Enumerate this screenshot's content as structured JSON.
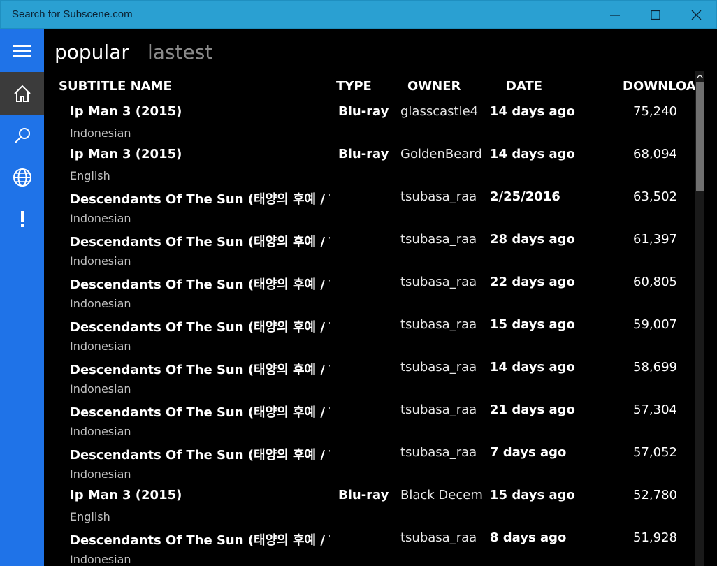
{
  "window": {
    "title": "Search for Subscene.com",
    "minimize_icon": "minimize-icon",
    "maximize_icon": "maximize-icon",
    "close_icon": "close-icon"
  },
  "sidebar": {
    "accent": "#1f73e8",
    "items": [
      {
        "icon": "hamburger-menu-icon"
      },
      {
        "icon": "home-icon",
        "selected": true
      },
      {
        "icon": "search-icon"
      },
      {
        "icon": "globe-icon"
      },
      {
        "icon": "exclamation-icon"
      }
    ]
  },
  "pivot": {
    "tabs": [
      {
        "label": "popular",
        "active": true
      },
      {
        "label": "lastest",
        "active": false
      }
    ]
  },
  "table": {
    "columns": [
      "SUBTITLE NAME",
      "TYPE",
      "OWNER",
      "DATE",
      "DOWNLOAD"
    ],
    "rows": [
      {
        "name": "Ip Man 3 (2015)",
        "lang": "Indonesian",
        "type": "Blu-ray",
        "owner": "glasscastle4",
        "date": "14 days ago",
        "downloads": "75,240"
      },
      {
        "name": "Ip Man 3 (2015)",
        "lang": "English",
        "type": "Blu-ray",
        "owner": "GoldenBeard",
        "date": "14 days ago",
        "downloads": "68,094"
      },
      {
        "name": "Descendants Of The Sun (태양의 후예 / Tae",
        "lang": "Indonesian",
        "type": "",
        "owner": "tsubasa_raa",
        "date": "2/25/2016",
        "downloads": "63,502"
      },
      {
        "name": "Descendants Of The Sun (태양의 후예 / Tae",
        "lang": "Indonesian",
        "type": "",
        "owner": "tsubasa_raa",
        "date": "28 days ago",
        "downloads": "61,397"
      },
      {
        "name": "Descendants Of The Sun (태양의 후예 / Tae",
        "lang": "Indonesian",
        "type": "",
        "owner": "tsubasa_raa",
        "date": "22 days ago",
        "downloads": "60,805"
      },
      {
        "name": "Descendants Of The Sun (태양의 후예 / Tae",
        "lang": "Indonesian",
        "type": "",
        "owner": "tsubasa_raa",
        "date": "15 days ago",
        "downloads": "59,007"
      },
      {
        "name": "Descendants Of The Sun (태양의 후예 / Tae",
        "lang": "Indonesian",
        "type": "",
        "owner": "tsubasa_raa",
        "date": "14 days ago",
        "downloads": "58,699"
      },
      {
        "name": "Descendants Of The Sun (태양의 후예 / Tae",
        "lang": "Indonesian",
        "type": "",
        "owner": "tsubasa_raa",
        "date": "21 days ago",
        "downloads": "57,304"
      },
      {
        "name": "Descendants Of The Sun (태양의 후예 / Tae",
        "lang": "Indonesian",
        "type": "",
        "owner": "tsubasa_raa",
        "date": "7 days ago",
        "downloads": "57,052"
      },
      {
        "name": "Ip Man 3 (2015)",
        "lang": "English",
        "type": "Blu-ray",
        "owner": "Black December",
        "date": "15 days ago",
        "downloads": "52,780"
      },
      {
        "name": "Descendants Of The Sun (태양의 후예 / Tae",
        "lang": "Indonesian",
        "type": "",
        "owner": "tsubasa_raa",
        "date": "8 days ago",
        "downloads": "51,928"
      }
    ]
  },
  "scrollbar": {
    "position": 0.0
  }
}
